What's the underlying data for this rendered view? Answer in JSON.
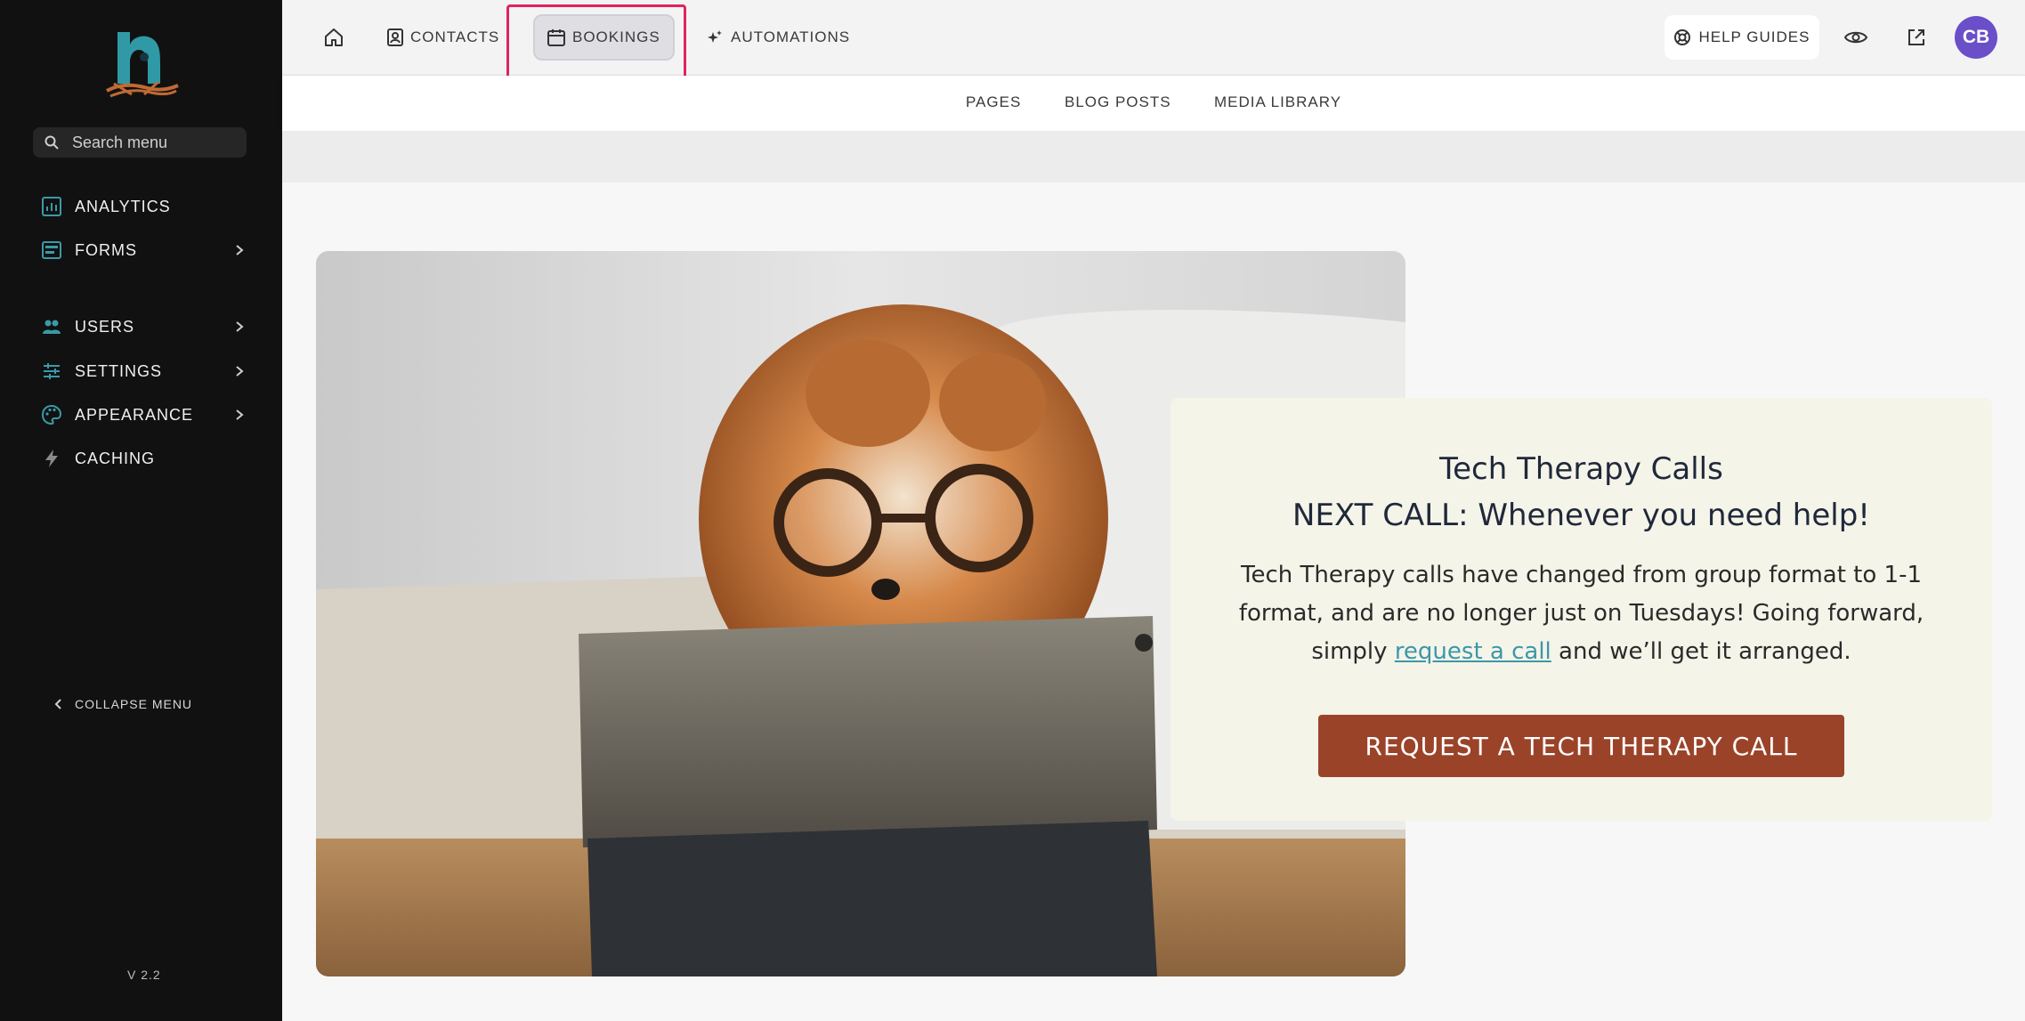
{
  "sidebar": {
    "search_placeholder": "Search menu",
    "items": [
      {
        "label": "ANALYTICS",
        "icon": "analytics-icon",
        "has_submenu": false
      },
      {
        "label": "FORMS",
        "icon": "forms-icon",
        "has_submenu": true
      },
      {
        "label": "USERS",
        "icon": "users-icon",
        "has_submenu": true
      },
      {
        "label": "SETTINGS",
        "icon": "settings-icon",
        "has_submenu": true
      },
      {
        "label": "APPEARANCE",
        "icon": "palette-icon",
        "has_submenu": true
      },
      {
        "label": "CACHING",
        "icon": "lightning-icon",
        "has_submenu": false
      }
    ],
    "collapse_label": "COLLAPSE MENU",
    "version": "V 2.2"
  },
  "topbar": {
    "nav": [
      {
        "label": "",
        "icon": "home-icon"
      },
      {
        "label": "CONTACTS",
        "icon": "contacts-icon"
      },
      {
        "label": "BOOKINGS",
        "icon": "calendar-icon",
        "active": true
      },
      {
        "label": "AUTOMATIONS",
        "icon": "sparkle-icon"
      }
    ],
    "help_label": "HELP GUIDES",
    "avatar_initials": "CB"
  },
  "subnav": {
    "items": [
      "PAGES",
      "BLOG POSTS",
      "MEDIA LIBRARY"
    ]
  },
  "card": {
    "title": "Tech Therapy Calls",
    "subtitle": "NEXT CALL: Whenever you need help!",
    "body_before": "Tech Therapy calls have changed from group format to 1-1 format, and are no longer just on Tuesdays! Going forward, simply ",
    "link_text": "request a call",
    "body_after": " and we’ll get it arranged.",
    "cta_label": "REQUEST A TECH THERAPY CALL"
  },
  "colors": {
    "sidebar_bg": "#111111",
    "accent_teal": "#3a9aa8",
    "cta_brown": "#9b4329",
    "avatar_purple": "#6a4fc9",
    "highlight_pink": "#e0245e"
  }
}
